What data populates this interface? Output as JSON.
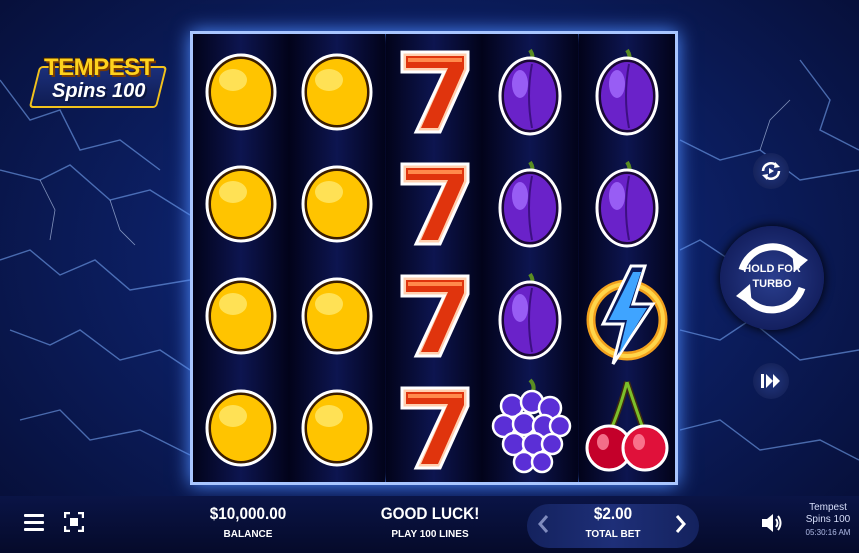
{
  "logo": {
    "title": "TEMPEST",
    "subtitle": "Spins 100"
  },
  "reels": {
    "columns": 5,
    "rows": 4,
    "grid": [
      [
        "lemon-icon",
        "lemon-icon",
        "seven-icon",
        "plum-icon",
        "plum-icon"
      ],
      [
        "lemon-icon",
        "lemon-icon",
        "seven-icon",
        "plum-icon",
        "plum-icon"
      ],
      [
        "lemon-icon",
        "lemon-icon",
        "seven-icon",
        "plum-icon",
        "lightning-bolt-icon"
      ],
      [
        "lemon-icon",
        "lemon-icon",
        "seven-icon",
        "grapes-icon",
        "cherries-icon"
      ]
    ]
  },
  "controls": {
    "autoplay_icon": "autoplay-icon",
    "spin_label": "HOLD FOR TURBO",
    "spin_label_line1": "HOLD FOR",
    "spin_label_line2": "TURBO",
    "quick_spin_icon": "fast-forward-icon"
  },
  "bottom_bar": {
    "balance_value": "$10,000.00",
    "balance_label": "BALANCE",
    "message": "GOOD LUCK!",
    "lines_label": "PLAY 100 LINES",
    "bet_value": "$2.00",
    "bet_label": "TOTAL BET",
    "decrease_icon": "chevron-left-icon",
    "increase_icon": "chevron-right-icon",
    "game_name_line1": "Tempest",
    "game_name_line2": "Spins 100",
    "clock": "05:30:16 AM"
  },
  "colors": {
    "background": "#0c1f63",
    "reel_border": "#a9c6ff",
    "accent_gold": "#ffd21e"
  }
}
